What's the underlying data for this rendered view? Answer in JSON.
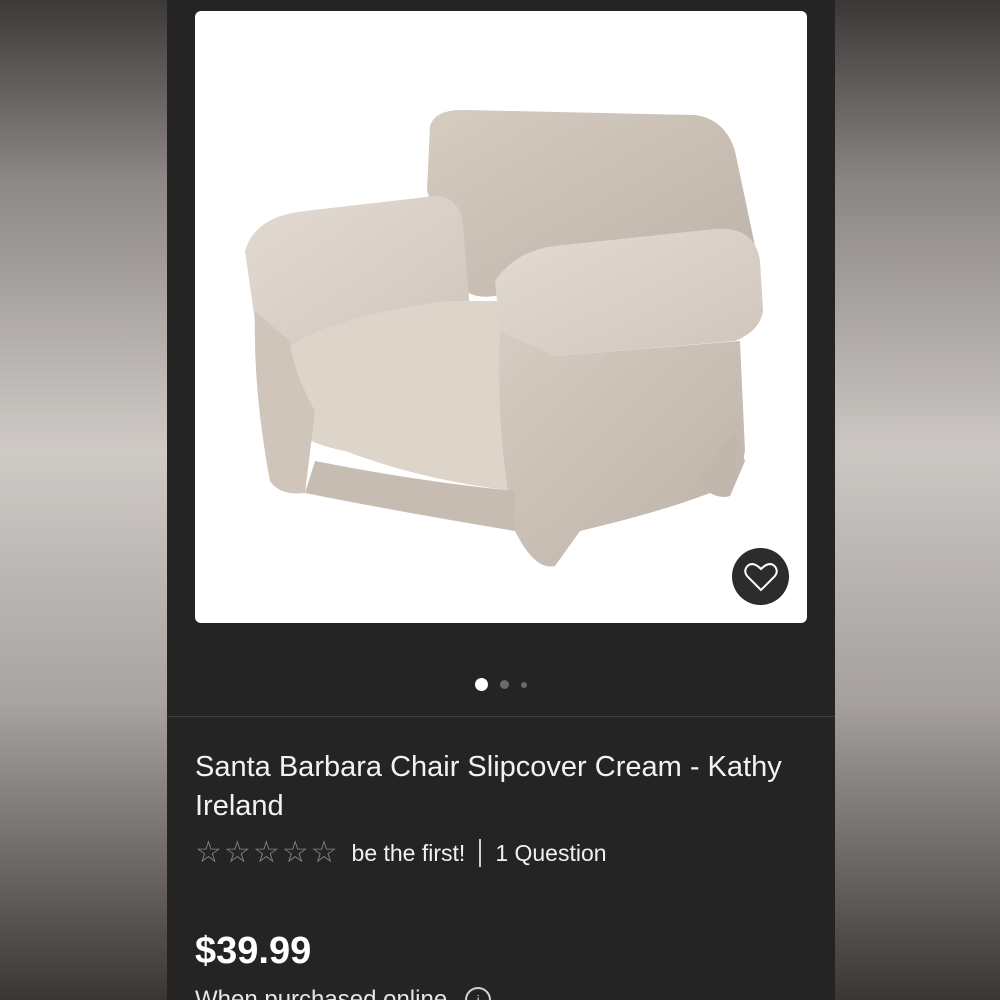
{
  "product": {
    "title": "Santa Barbara Chair Slipcover Cream - Kathy Ireland",
    "rating": {
      "stars_filled": 0,
      "stars_total": 5,
      "review_prompt": "be the first!",
      "questions": "1 Question"
    },
    "price": "$39.99",
    "price_note": "When purchased online",
    "image_carousel": {
      "total": 3,
      "active_index": 0
    }
  },
  "icons": {
    "favorite": "heart-icon",
    "info": "info-icon",
    "star": "star-outline-icon"
  },
  "colors": {
    "page_bg": "#242424",
    "text": "#f2f2f2",
    "star_empty": "#8a8a8a",
    "fav_button": "#2c2c2c"
  }
}
